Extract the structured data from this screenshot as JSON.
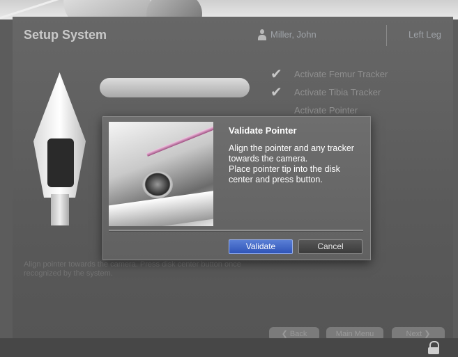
{
  "app": {
    "title": "Setup System",
    "user": "Miller, John",
    "side": "Left Leg"
  },
  "steps": [
    {
      "label": "Activate Femur Tracker"
    },
    {
      "label": "Activate Tibia Tracker"
    },
    {
      "label": "Activate Pointer"
    }
  ],
  "hint": "Align pointer towards the camera. Press disk center button once recognized by the system.",
  "nav": {
    "back": "Back",
    "main_menu": "Main Menu",
    "next": "Next"
  },
  "dialog": {
    "title": "Validate Pointer",
    "text": "Align the pointer and any tracker towards the camera.\nPlace pointer tip into the disk center and press button.",
    "validate_label": "Validate",
    "cancel_label": "Cancel"
  },
  "colors": {
    "accent": "#2f54b8",
    "background": "#5c5c5c"
  }
}
